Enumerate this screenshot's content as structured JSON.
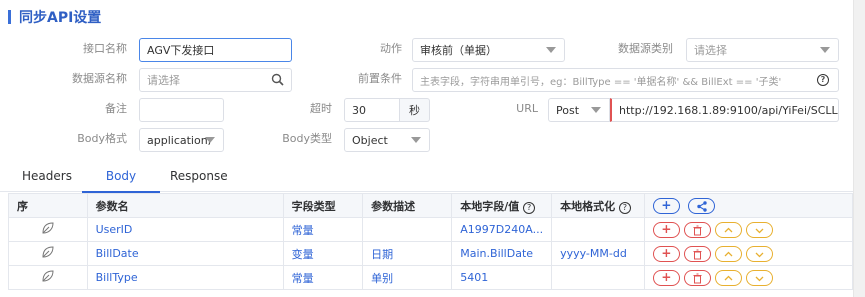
{
  "page": {
    "title": "同步API设置"
  },
  "form": {
    "iface_name": {
      "label": "接口名称",
      "value": "AGV下发接口"
    },
    "action": {
      "label": "动作",
      "value": "审核前（单据）"
    },
    "ds_category": {
      "label": "数据源类别",
      "placeholder": "请选择"
    },
    "ds_name": {
      "label": "数据源名称",
      "placeholder": "请选择"
    },
    "precondition": {
      "label": "前置条件",
      "placeholder": "主表字段，字符串用单引号，eg：BillType == '单据名称' && BillExt == '子类'"
    },
    "remark": {
      "label": "备注",
      "value": ""
    },
    "timeout": {
      "label": "超时",
      "value": "30",
      "unit": "秒"
    },
    "url": {
      "label": "URL",
      "method": "Post",
      "value": "http://192.168.1.89:9100/api/YiFei/SCLLD..."
    },
    "body_format": {
      "label": "Body格式",
      "value": "application,"
    },
    "body_type": {
      "label": "Body类型",
      "value": "Object"
    }
  },
  "tabs": [
    "Headers",
    "Body",
    "Response"
  ],
  "table": {
    "headers": [
      "序",
      "参数名",
      "字段类型",
      "参数描述",
      "本地字段/值",
      "本地格式化"
    ],
    "rows": [
      {
        "name": "UserID",
        "type": "常量",
        "desc": "",
        "local": "A1997D240A...",
        "fmt": ""
      },
      {
        "name": "BillDate",
        "type": "变量",
        "desc": "日期",
        "local": "Main.BillDate",
        "fmt": "yyyy-MM-dd"
      },
      {
        "name": "BillType",
        "type": "常量",
        "desc": "单别",
        "local": "5401",
        "fmt": ""
      }
    ]
  },
  "icons": {
    "row_marker": "leaf-icon",
    "search": "search-icon",
    "help": "help-circle-icon",
    "add": "plus-icon",
    "share": "share-icon",
    "delete": "trash-icon",
    "up": "chevron-up-icon",
    "down": "chevron-down-icon"
  },
  "colors": {
    "primary": "#2f64d6",
    "danger": "#e05252",
    "warning": "#e8b030"
  }
}
